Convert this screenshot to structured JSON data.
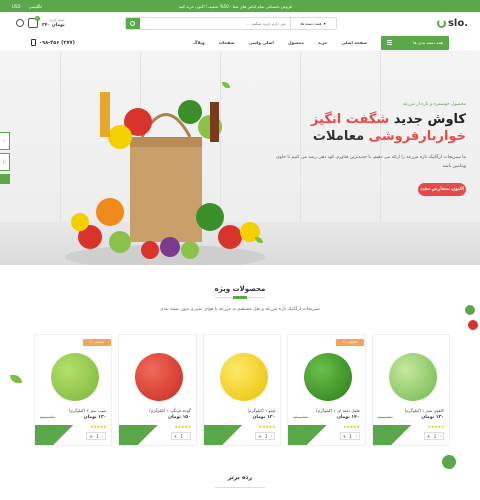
{
  "topbar": {
    "currency": "USD",
    "language": "انگلیسی",
    "promo": "فروش تابستانی تمام لباس های شنا - 50% تخفیف! اکنون خرید کنید"
  },
  "header": {
    "cart_label": "سبد خرید",
    "cart_amount": "۲۴۰ تومان",
    "cart_count": "0",
    "search_placeholder": "من دارم خرید میکنم ...",
    "search_category": "همه دسته ها",
    "logo_text": "slo."
  },
  "nav": {
    "phone": "۰۹۸-۴۵۶ (۲۷۷)",
    "items": [
      "صفحه اصلی",
      "خرید",
      "محصول",
      "اصلی واسی",
      "صفحات",
      "وبلاگ"
    ],
    "category_button": "همه دسته بندی ها"
  },
  "hero": {
    "pre": "محصول خوشمزه و تازه از مزرعه",
    "line1_a": "کاوش جدید",
    "line1_b": "شگفت انگیز",
    "line2_a": "خواربارفروشی",
    "line2_b": "معاملات",
    "desc": "ما سبزیجات ارگانیک تازه مزرعه را ارائه می دهیم، با جدیدترین فناوری کود دهی رشد می کنیم تا حاوی ویتامین باشد",
    "cta": "اکنون سفارش دهید",
    "side_chips": [
      "ت",
      "پیک",
      "",
      ""
    ]
  },
  "section": {
    "title": "محصولات ویژه",
    "desc": "سبزیجات ارگانیک تازه مزرعه و نقل مستقیم به مزرعه با هوای تمیز و بدون بسته بندی"
  },
  "products": [
    {
      "name": "سیب سبز ۲ (کیلوگرم)",
      "price": "۱۳۰ تومان",
      "old": "۱۶۰ تومان",
      "badge": "۲۰ تخفیف",
      "color": "#8bc34a",
      "qty": "1"
    },
    {
      "name": "گوجه فرنگی ۱ (کیلوگرم)",
      "price": "۱۵۰ تومان",
      "old": "",
      "badge": "",
      "color": "#d9342b",
      "qty": "1"
    },
    {
      "name": "لیمو ۱ (کیلوگرم)",
      "price": "۱۲۰ تومان",
      "old": "",
      "badge": "",
      "color": "#f5d000",
      "qty": "1"
    },
    {
      "name": "فلفل دلمه ای ۱ (کیلوگرم)",
      "price": "۱۴۰ تومان",
      "old": "۱۸۰ تومان",
      "badge": "۲۰ تخفیف",
      "color": "#3a8f2a",
      "qty": "1"
    },
    {
      "name": "کاهوی سبز ۱ (کیلوگرم)",
      "price": "۱۳۰ تومان",
      "old": "۱۸۰ تومان",
      "badge": "",
      "color": "#6db84a",
      "qty": "1"
    }
  ],
  "section2": {
    "title": "رده برتر"
  },
  "colors": {
    "accent": "#5aa84a",
    "cta": "#e84a4a"
  }
}
